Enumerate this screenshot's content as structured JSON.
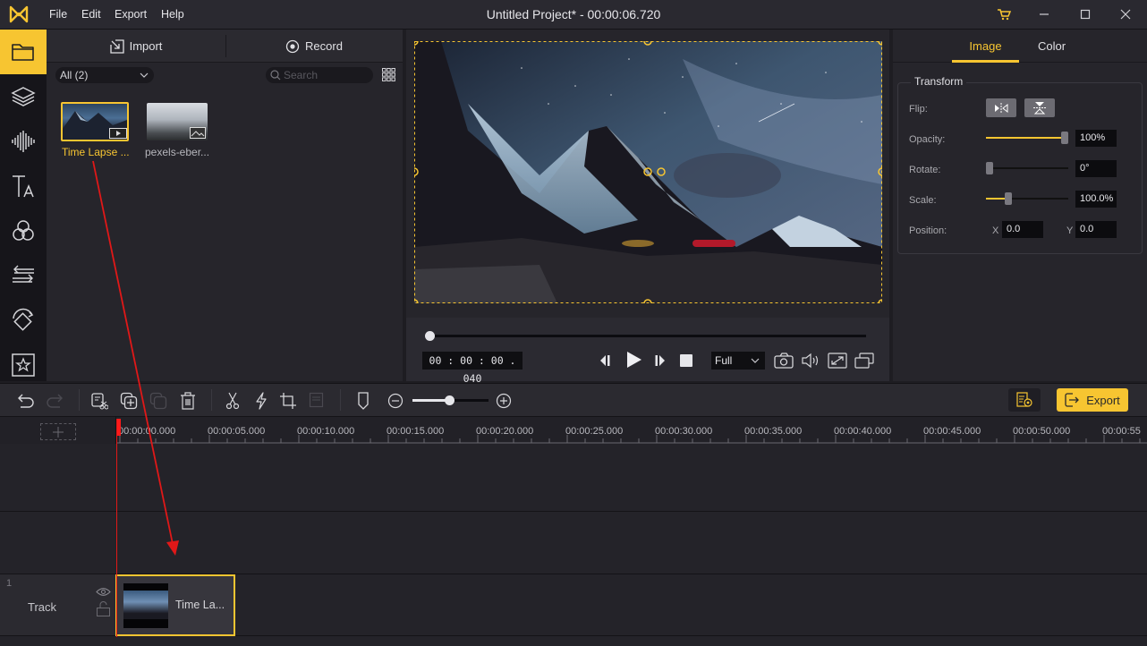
{
  "app": {
    "title": "Untitled Project* - 00:00:06.720",
    "menu": [
      "File",
      "Edit",
      "Export",
      "Help"
    ],
    "accent_color": "#f7c531"
  },
  "sidebar": {
    "items": [
      {
        "icon": "folder-icon",
        "active": true
      },
      {
        "icon": "layers-icon"
      },
      {
        "icon": "audio-wave-icon"
      },
      {
        "icon": "text-icon"
      },
      {
        "icon": "filters-icon"
      },
      {
        "icon": "transitions-icon"
      },
      {
        "icon": "animation-icon"
      },
      {
        "icon": "sticker-star-icon"
      }
    ]
  },
  "media": {
    "import_label": "Import",
    "record_label": "Record",
    "filter_value": "All (2)",
    "search_placeholder": "Search",
    "items": [
      {
        "name": "Time Lapse ...",
        "type": "video",
        "selected": true
      },
      {
        "name": "pexels-eber...",
        "type": "image",
        "selected": false
      }
    ]
  },
  "preview": {
    "timecode": "00 : 00 : 00 . 040",
    "progress": 0.0,
    "zoom_select": "Full"
  },
  "properties": {
    "tabs": [
      "Image",
      "Color"
    ],
    "active_tab": "Image",
    "group_title": "Transform",
    "flip_label": "Flip:",
    "opacity": {
      "label": "Opacity:",
      "value": "100%",
      "fraction": 1.0
    },
    "rotate": {
      "label": "Rotate:",
      "value": "0°",
      "fraction": 0.0
    },
    "scale": {
      "label": "Scale:",
      "value": "100.0%",
      "fraction": 0.25
    },
    "position": {
      "label": "Position:",
      "x_label": "X",
      "x": "0.0",
      "y_label": "Y",
      "y": "0.0"
    }
  },
  "timeline": {
    "export_label": "Export",
    "zoom_fraction": 0.49,
    "ruler": [
      "00:00:00.000",
      "00:00:05.000",
      "00:00:10.000",
      "00:00:15.000",
      "00:00:20.000",
      "00:00:25.000",
      "00:00:30.000",
      "00:00:35.000",
      "00:00:40.000",
      "00:00:45.000",
      "00:00:50.000",
      "00:00:55"
    ],
    "track": {
      "number": "1",
      "name": "Track",
      "clip_label": "Time La..."
    }
  }
}
